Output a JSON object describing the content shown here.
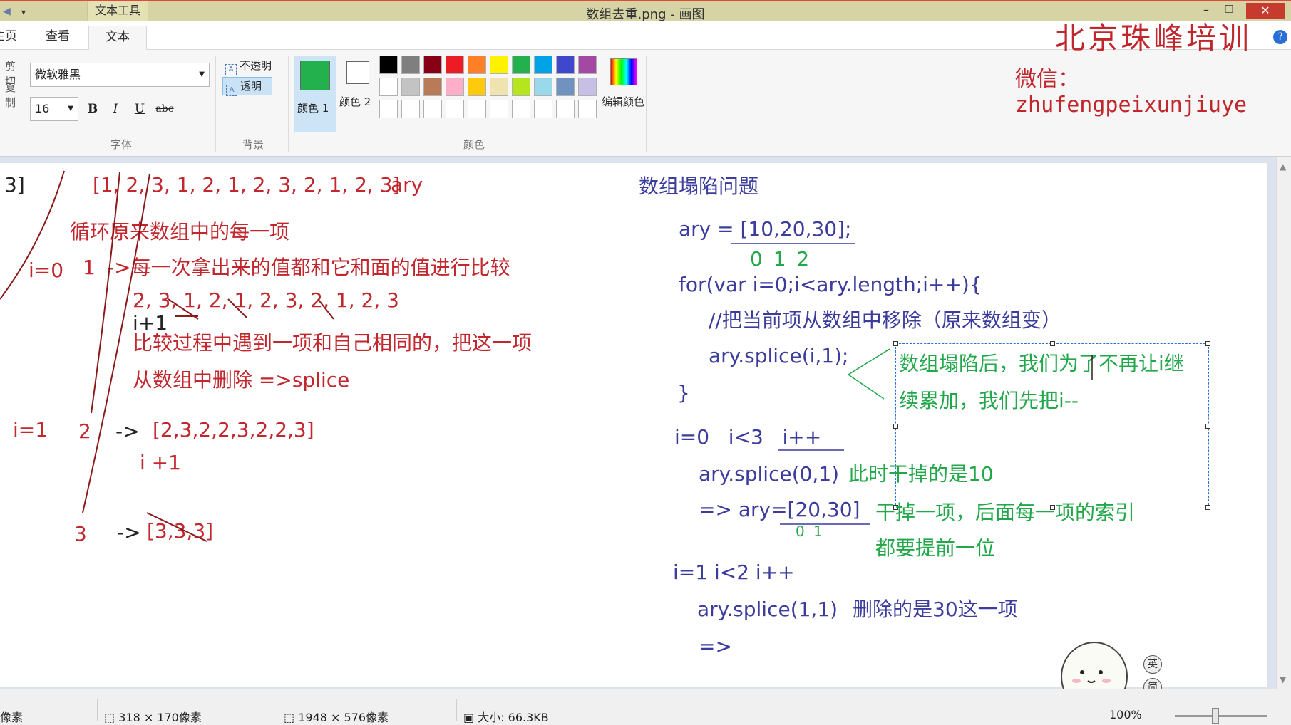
{
  "window": {
    "title": "数组去重.png - 画图",
    "context_tab": "文本工具",
    "minimize": "–",
    "maximize": "□",
    "close": "✕"
  },
  "tabs": {
    "home": "主页",
    "view": "查看",
    "text": "文本"
  },
  "clipboard": {
    "cut": "剪切",
    "copy": "复制"
  },
  "font": {
    "name": "微软雅黑",
    "size": "16",
    "bold": "B",
    "italic": "I",
    "underline": "U",
    "strike": "abc",
    "group_label": "字体"
  },
  "background": {
    "opaque": "不透明",
    "transparent": "透明",
    "group_label": "背景"
  },
  "colors": {
    "color1_label": "颜色 1",
    "color2_label": "颜色 2",
    "color1": "#22b14c",
    "color2": "#ffffff",
    "edit_label": "编辑颜色",
    "group_label": "颜色",
    "palette_row1": [
      "#000000",
      "#7f7f7f",
      "#880015",
      "#ed1c24",
      "#ff7f27",
      "#fff200",
      "#22b14c",
      "#00a2e8",
      "#3f48cc",
      "#a349a4"
    ],
    "palette_row2": [
      "#ffffff",
      "#c3c3c3",
      "#b97a57",
      "#ffaec9",
      "#ffc90e",
      "#efe4b0",
      "#b5e61d",
      "#99d9ea",
      "#7092be",
      "#c8bfe7"
    ]
  },
  "watermark": {
    "brand": "北京珠峰培训",
    "wechat": "微信：zhufengpeixunjiuye"
  },
  "canvas": {
    "left": {
      "frag": "3]",
      "array": "[1, 2, 3, 1, 2, 1, 2, 3, 2, 1, 2, 3]",
      "ary": "ary",
      "loop_desc": "循环原来数组中的每一项",
      "i0": "i=0",
      "one": "1",
      "compare_desc": "->每一次拿出来的值都和它和面的值进行比较",
      "rest": "2, 3, 1, 2, 1, 2, 3, 2, 1, 2, 3",
      "iplus1_a": "i+1",
      "compare_process": "比较过程中遇到一项和自己相同的，把这一项",
      "delete_from": "从数组中删除 =>splice",
      "i1": "i=1",
      "two": "2",
      "arrow2": "->",
      "arr2": "[2,3,2,2,3,2,2,3]",
      "iplus1_b": "i +1",
      "three": "3",
      "arrow3": "->",
      "arr3": "[3,3,3]"
    },
    "right": {
      "title": "数组塌陷问题",
      "decl": "ary = [10,20,30];",
      "idx": "0  1  2",
      "for": "for(var i=0;i<ary.length;i++){",
      "comment": "//把当前项从数组中移除（原来数组变）",
      "splice": "ary.splice(i,1);",
      "close_brace": "}",
      "note1": "数组塌陷后，我们为了不再让i继",
      "note2": "续累加，我们先把i--",
      "iter0": "i=0   i<3   i++",
      "call0": "ary.splice(0,1)",
      "call0_note": "此时干掉的是10",
      "res0": "=> ary=[20,30]",
      "res0_note1": "干掉一项，后面每一项的索引",
      "res0_note2": "都要提前一位",
      "idx2": "0  1",
      "iter1": "i=1  i<2  i++",
      "call1": "ary.splice(1,1)",
      "call1_note": "删除的是30这一项",
      "res1": "=>"
    }
  },
  "side_buttons": [
    "英",
    "简",
    "☺"
  ],
  "status": {
    "pixels": "像素",
    "selection": "318 × 170像素",
    "image_size": "1948 × 576像素",
    "file_size": "大小: 66.3KB",
    "zoom": "100%"
  }
}
